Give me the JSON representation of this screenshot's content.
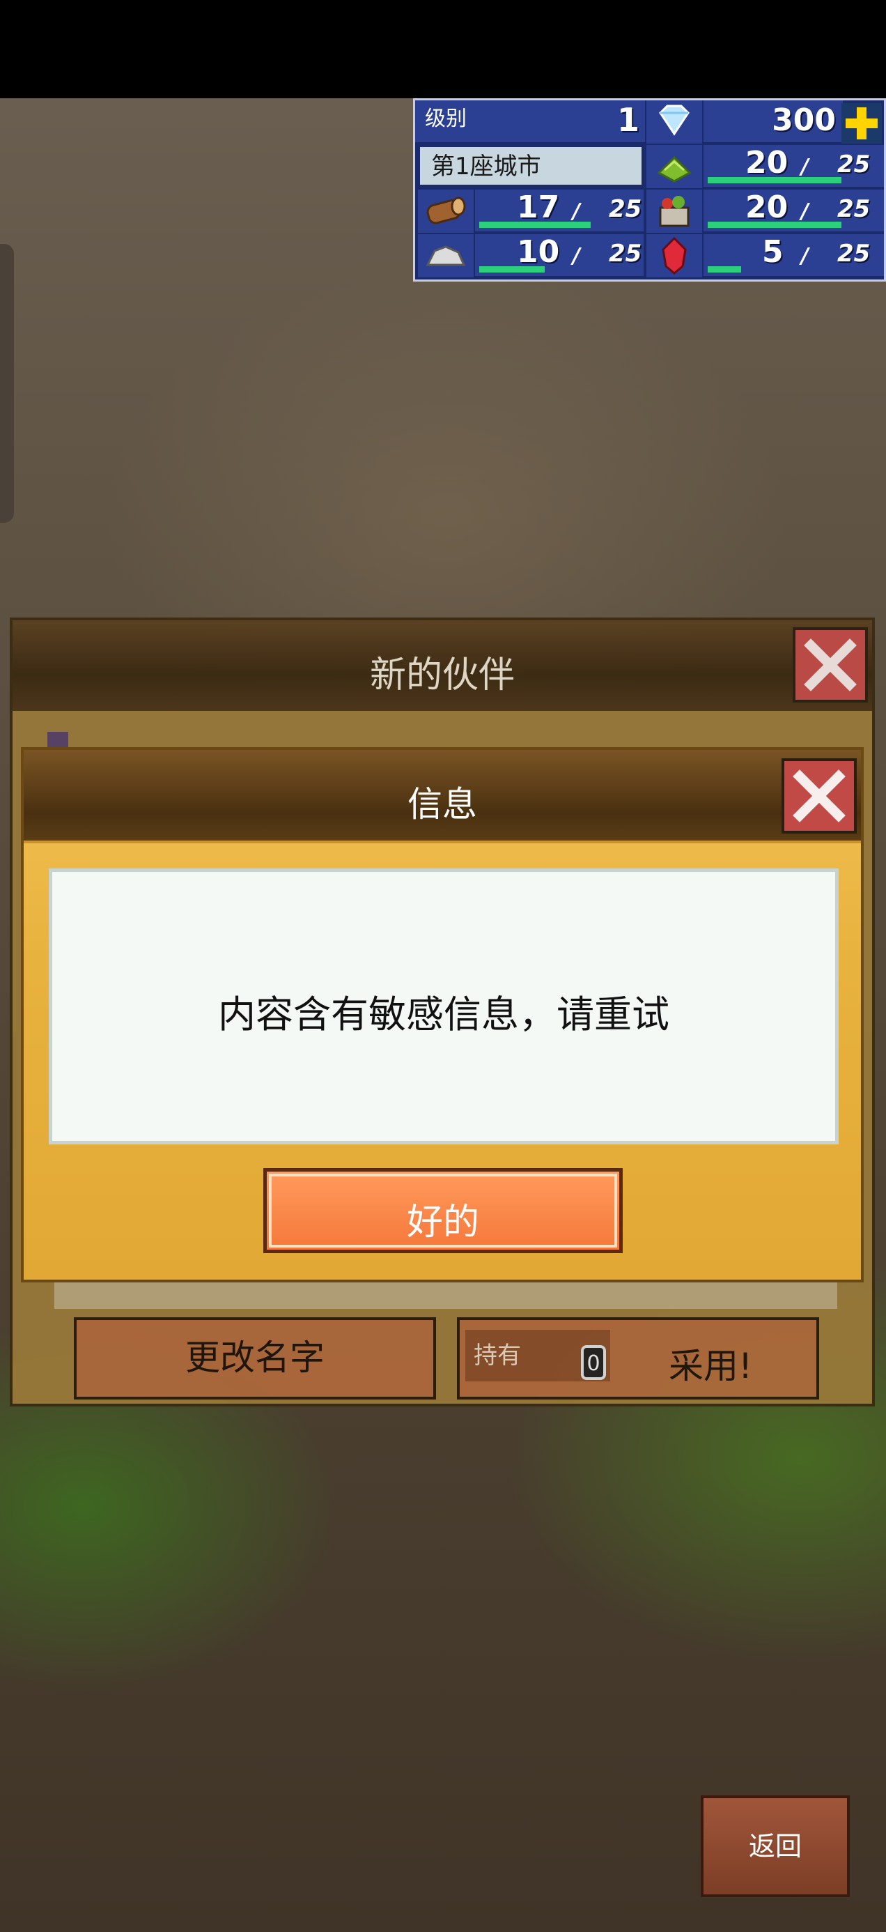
{
  "hud": {
    "level_label": "级别",
    "level_value": "1",
    "gems": "300",
    "city_name": "第1座城市",
    "resources": [
      {
        "icon": "wheat-icon",
        "current": "20",
        "max": "25",
        "fill": 0.8
      },
      {
        "icon": "wood-log-icon",
        "current": "17",
        "max": "25",
        "fill": 0.68
      },
      {
        "icon": "food-basket-icon",
        "current": "20",
        "max": "25",
        "fill": 0.8
      },
      {
        "icon": "stone-ore-icon",
        "current": "10",
        "max": "25",
        "fill": 0.4
      },
      {
        "icon": "red-gem-icon",
        "current": "5",
        "max": "25",
        "fill": 0.2
      }
    ],
    "slash": "/"
  },
  "new_companion": {
    "title": "新的伙伴",
    "rename_label": "更改名字",
    "hold_label": "持有",
    "hold_count": "0",
    "adopt_label": "采用!"
  },
  "info_dialog": {
    "title": "信息",
    "message": "内容含有敏感信息，请重试",
    "ok_label": "好的"
  },
  "back_label": "返回",
  "colors": {
    "hud_bg": "#2b3f93",
    "bar_green": "#2ad17a",
    "dialog_gold": "#e8b23e",
    "ok_orange": "#f5783a",
    "close_red": "#c24a46"
  }
}
